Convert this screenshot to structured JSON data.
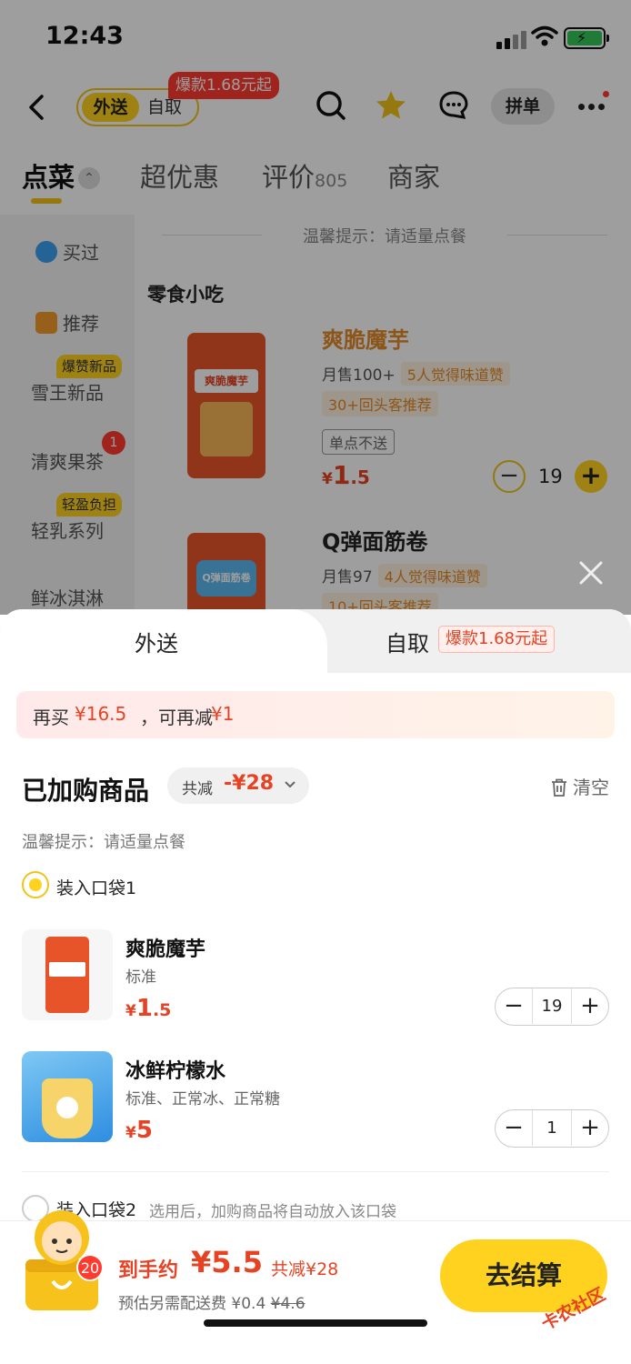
{
  "status": {
    "time": "12:43"
  },
  "nav": {
    "mode_on": "外送",
    "mode_off": "自取",
    "hot_badge": "爆款1.68元起",
    "pin": "拼单"
  },
  "tabs": [
    {
      "label": "点菜"
    },
    {
      "label": "超优惠"
    },
    {
      "label": "评价",
      "count": "805"
    },
    {
      "label": "商家"
    }
  ],
  "sidebar": {
    "items": [
      {
        "label": "买过"
      },
      {
        "label": "推荐"
      },
      {
        "label": "雪王新品",
        "badge": "爆赞新品"
      },
      {
        "label": "清爽果茶",
        "count": "1"
      },
      {
        "label": "轻乳系列",
        "badge": "轻盈负担"
      },
      {
        "label": "鲜冰淇淋"
      }
    ]
  },
  "menu": {
    "tip": "温馨提示：请适量点餐",
    "category": "零食小吃",
    "products": [
      {
        "name": "爽脆魔芋",
        "sales": "月售100+",
        "tag": "5人觉得味道赞",
        "tag2": "30+回头客推荐",
        "note": "单点不送",
        "price_sym": "¥",
        "price_int": "1",
        "price_dec": ".5",
        "qty": "19"
      },
      {
        "name": "Q弹面筋卷",
        "sales": "月售97",
        "tag": "4人觉得味道赞",
        "tag2": "10+回头客推荐"
      }
    ],
    "img_text_1": "爽脆魔芋",
    "img_text_2": "Q弹面筋卷"
  },
  "cart": {
    "tab_delivery": "外送",
    "tab_pickup": "自取",
    "tab_hot": "爆款1.68元起",
    "promo": {
      "p1": "再买",
      "amt1": "¥16.5",
      "p2": "，可再减",
      "amt2": "¥1"
    },
    "title": "已加购商品",
    "discount_label": "共减",
    "discount_value": "-¥28",
    "clear": "清空",
    "tip": "温馨提示：请适量点餐",
    "bag1": "装入口袋1",
    "bag2": "装入口袋2",
    "bag2_hint": "选用后，加购商品将自动放入该口袋",
    "items": [
      {
        "name": "爽脆魔芋",
        "spec": "标准",
        "price_sym": "¥",
        "price_int": "1",
        "price_dec": ".5",
        "qty": "19"
      },
      {
        "name": "冰鲜柠檬水",
        "spec": "标准、正常冰、正常糖",
        "price_sym": "¥",
        "price_int": "5",
        "price_dec": "",
        "qty": "1"
      }
    ]
  },
  "checkout": {
    "count": "20",
    "total_label": "到手约",
    "total": "¥5.5",
    "save": "共减¥28",
    "delivery_label": "预估另需配送费",
    "delivery_fee": "¥0.4",
    "delivery_orig": "¥4.6",
    "button": "去结算"
  },
  "watermark": "卡农社区",
  "colors": {
    "accent": "#ffd21f",
    "price": "#e64325",
    "badge": "#ff3b30"
  }
}
